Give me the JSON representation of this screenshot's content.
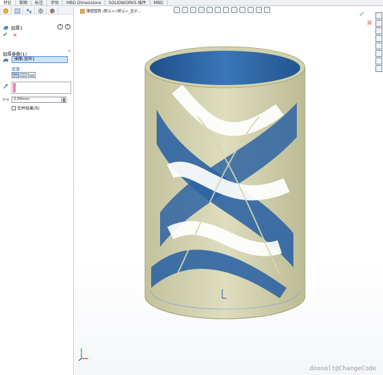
{
  "tabs": [
    "特征",
    "草图",
    "标注",
    "评估",
    "MBD Dimensions",
    "SOLIDWORKS 插件",
    "MBD"
  ],
  "panel": {
    "feature_title": "加厚1",
    "help_a": "?",
    "help_b": "?",
    "ok_symbol": "✔",
    "cancel_symbol": "✕",
    "params_header": "加厚参数(1)",
    "collapse": "^",
    "face_value": "曲面-放样1",
    "thickness_label": "厚度:",
    "distance_value": "2.00mm",
    "merge_label": "合并结果(R)",
    "splitter": "‹"
  },
  "viewport": {
    "tree_path": "薄壁圆筒 (默认<<默认>_显示...",
    "ok_symbol": "✔",
    "cancel_symbol": "✖",
    "watermark": "doooolt@ChangeCode"
  },
  "colors": {
    "model_blue": "#2d64a3",
    "model_tan": "#c9c9a4",
    "accent_blue": "#4b8ed1",
    "selection_pink": "#f07fb8"
  },
  "icons": [
    "feature-manager-icon",
    "property-manager-icon",
    "config-manager-icon",
    "dimxpert-icon",
    "display-manager-icon"
  ]
}
